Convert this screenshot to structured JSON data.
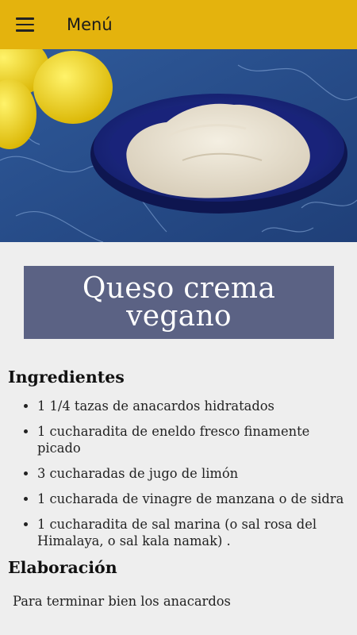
{
  "appbar": {
    "menu_icon": "hamburger-menu-icon",
    "title": "Menú",
    "background": "#e4b30d"
  },
  "hero": {
    "image": "photo of vegan cream cheese in a blue bowl with lemons"
  },
  "recipe": {
    "title": "Queso crema vegano",
    "title_background": "#5b6284",
    "ingredients_heading": "Ingredientes",
    "ingredients": [
      "1 1/4 tazas de anacardos hidratados",
      "1 cucharadita de eneldo fresco finamente picado",
      "3 cucharadas de jugo de limón",
      "1 cucharada de vinagre de manzana o de sidra",
      "1 cucharadita de sal marina (o sal rosa del Himalaya, o sal kala namak) ."
    ],
    "preparation_heading": "Elaboración",
    "preparation_first_line": "Para terminar bien los anacardos"
  }
}
